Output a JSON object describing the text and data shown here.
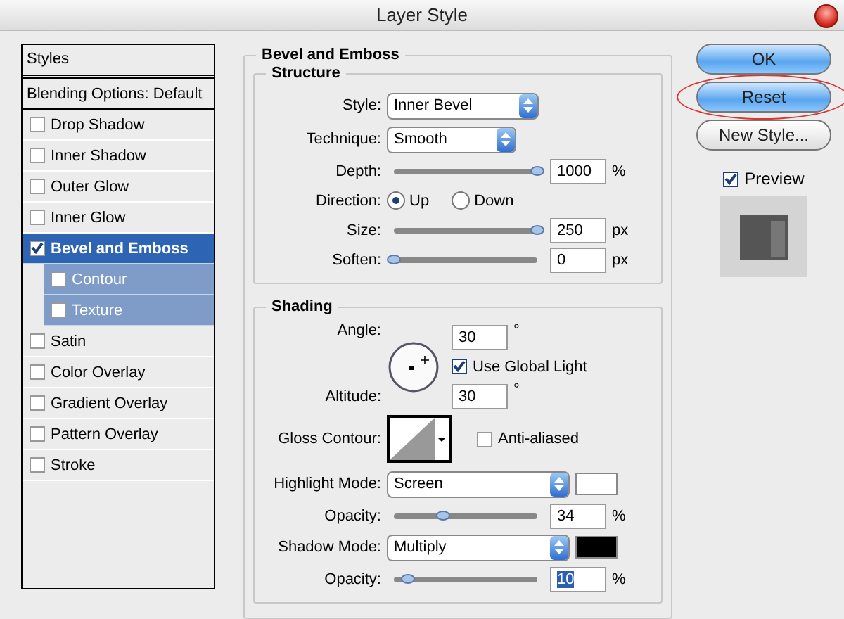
{
  "window": {
    "title": "Layer Style"
  },
  "styles_panel": {
    "header": "Styles",
    "blending": "Blending Options: Default",
    "items": [
      {
        "label": "Drop Shadow",
        "checked": false,
        "selected": false
      },
      {
        "label": "Inner Shadow",
        "checked": false,
        "selected": false
      },
      {
        "label": "Outer Glow",
        "checked": false,
        "selected": false
      },
      {
        "label": "Inner Glow",
        "checked": false,
        "selected": false
      },
      {
        "label": "Bevel and Emboss",
        "checked": true,
        "selected": true,
        "children": [
          {
            "label": "Contour",
            "checked": false
          },
          {
            "label": "Texture",
            "checked": false
          }
        ]
      },
      {
        "label": "Satin",
        "checked": false,
        "selected": false
      },
      {
        "label": "Color Overlay",
        "checked": false,
        "selected": false
      },
      {
        "label": "Gradient Overlay",
        "checked": false,
        "selected": false
      },
      {
        "label": "Pattern Overlay",
        "checked": false,
        "selected": false
      },
      {
        "label": "Stroke",
        "checked": false,
        "selected": false
      }
    ]
  },
  "bevel": {
    "title": "Bevel and Emboss",
    "structure": {
      "title": "Structure",
      "rows": [
        {
          "kind": "select",
          "label": "Style:",
          "value": "Inner Bevel"
        },
        {
          "kind": "select",
          "label": "Technique:",
          "value": "Smooth"
        },
        {
          "kind": "slider",
          "label": "Depth:",
          "level": 1,
          "value": "1000",
          "unit": "%"
        },
        {
          "kind": "radio",
          "label": "Direction:",
          "options": [
            {
              "label": "Up",
              "selected": true
            },
            {
              "label": "Down",
              "selected": false
            }
          ]
        },
        {
          "kind": "slider",
          "label": "Size:",
          "level": 1,
          "value": "250",
          "unit": "px"
        },
        {
          "kind": "slider",
          "label": "Soften:",
          "level": 0,
          "value": "0",
          "unit": "px"
        }
      ]
    },
    "shading": {
      "title": "Shading",
      "angle": {
        "label": "Angle:",
        "value": "30",
        "unit": "°"
      },
      "global_light": {
        "label": "Use Global Light",
        "checked": true
      },
      "altitude": {
        "label": "Altitude:",
        "value": "30",
        "unit": "°"
      },
      "gloss": {
        "label": "Gloss Contour:",
        "anti_aliased": {
          "label": "Anti-aliased",
          "checked": false
        }
      },
      "rows": [
        {
          "kind": "mode",
          "label": "Highlight Mode:",
          "value": "Screen",
          "color": "#ffffff"
        },
        {
          "kind": "slider",
          "label": "Opacity:",
          "level": 0.34,
          "value": "34",
          "unit": "%",
          "text_selected": false
        },
        {
          "kind": "mode",
          "label": "Shadow Mode:",
          "value": "Multiply",
          "color": "#000000"
        },
        {
          "kind": "slider",
          "label": "Opacity:",
          "level": 0.1,
          "value": "10",
          "unit": "%",
          "text_selected": true
        }
      ]
    }
  },
  "buttons": [
    {
      "label": "OK",
      "kind": "primary",
      "circled": false
    },
    {
      "label": "Reset",
      "kind": "primary",
      "circled": true
    },
    {
      "label": "New Style...",
      "kind": "plain",
      "circled": false
    }
  ],
  "preview": {
    "label": "Preview",
    "checked": true
  }
}
